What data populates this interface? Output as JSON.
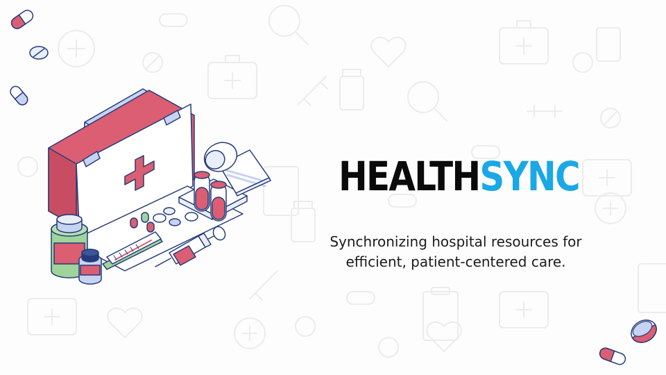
{
  "brand": {
    "part1": "HEALTH",
    "part2": "SYNC"
  },
  "tagline": {
    "line1": "Synchronizing hospital resources for",
    "line2": "efficient, patient-centered care."
  },
  "colors": {
    "brand_dark": "#0a0a0a",
    "brand_accent": "#1aa8e6",
    "kit_red": "#db5e72",
    "outline_navy": "#253b7a",
    "pill_blue": "#c7d3f2",
    "bottle_green": "#9fd49a"
  },
  "icons": [
    "first-aid-kit-icon",
    "capsule-icon",
    "tablet-icon",
    "medicine-bottle-icon",
    "thermometer-icon",
    "syringe-icon",
    "test-tube-rack-icon",
    "bandage-roll-icon"
  ]
}
